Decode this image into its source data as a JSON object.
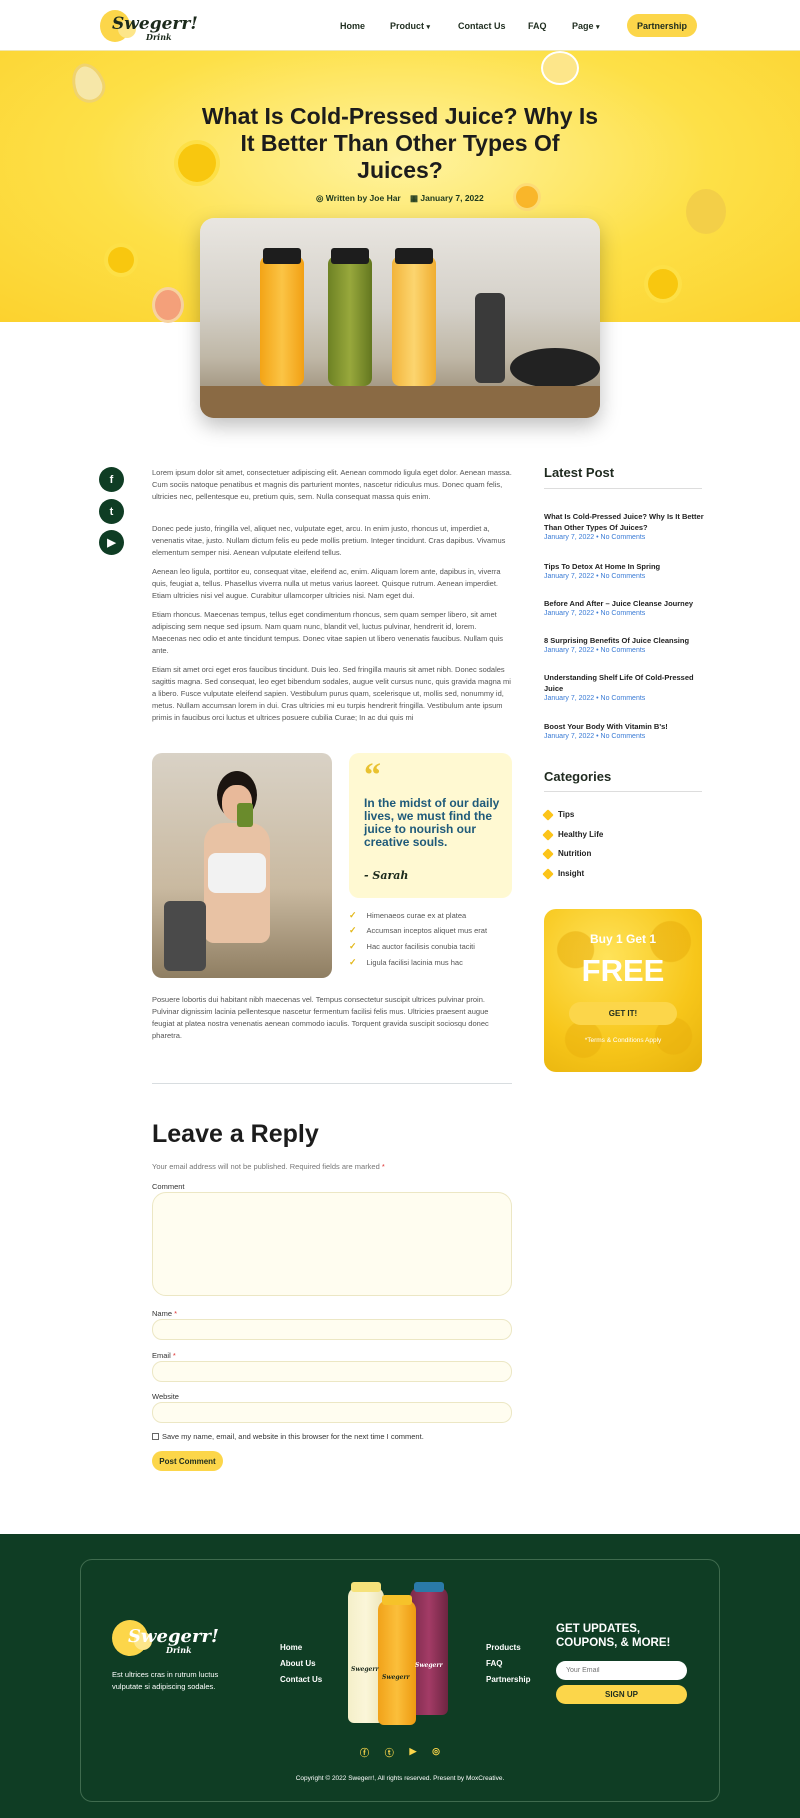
{
  "header": {
    "logo_text": "Swegerr!",
    "logo_sub": "Drink",
    "nav": [
      "Home",
      "Product",
      "Contact Us",
      "FAQ",
      "Page"
    ],
    "partnership_button": "Partnership"
  },
  "hero": {
    "title": "What Is Cold-Pressed Juice? Why Is It Better Than Other Types Of Juices?",
    "author": "Written by Joe Har",
    "date": "January 7, 2022"
  },
  "article": {
    "paragraphs": [
      "Lorem ipsum dolor sit amet, consectetuer adipiscing elit. Aenean commodo ligula eget dolor. Aenean massa. Cum sociis natoque penatibus et magnis dis parturient montes, nascetur ridiculus mus. Donec quam felis, ultricies nec, pellentesque eu, pretium quis, sem. Nulla consequat massa quis enim.",
      "Donec pede justo, fringilla vel, aliquet nec, vulputate eget, arcu. In enim justo, rhoncus ut, imperdiet a, venenatis vitae, justo. Nullam dictum felis eu pede mollis pretium. Integer tincidunt. Cras dapibus. Vivamus elementum semper nisi. Aenean vulputate eleifend tellus.",
      "Aenean leo ligula, porttitor eu, consequat vitae, eleifend ac, enim. Aliquam lorem ante, dapibus in, viverra quis, feugiat a, tellus. Phasellus viverra nulla ut metus varius laoreet. Quisque rutrum. Aenean imperdiet. Etiam ultricies nisi vel augue. Curabitur ullamcorper ultricies nisi. Nam eget dui.",
      "Etiam rhoncus. Maecenas tempus, tellus eget condimentum rhoncus, sem quam semper libero, sit amet adipiscing sem neque sed ipsum. Nam quam nunc, blandit vel, luctus pulvinar, hendrerit id, lorem. Maecenas nec odio et ante tincidunt tempus. Donec vitae sapien ut libero venenatis faucibus. Nullam quis ante.",
      "Etiam sit amet orci eget eros faucibus tincidunt. Duis leo. Sed fringilla mauris sit amet nibh. Donec sodales sagittis magna. Sed consequat, leo eget bibendum sodales, augue velit cursus nunc, quis gravida magna mi a libero. Fusce vulputate eleifend sapien. Vestibulum purus quam, scelerisque ut, mollis sed, nonummy id, metus. Nullam accumsan lorem in dui. Cras ultricies mi eu turpis hendrerit fringilla. Vestibulum ante ipsum primis in faucibus orci luctus et ultrices posuere cubilia Curae; In ac dui quis mi"
    ],
    "quote_mark": "“",
    "quote": "In the midst of our daily lives, we must find the juice to nourish our creative souls.",
    "quote_author": "- Sarah",
    "checklist": [
      "Himenaeos curae ex at platea",
      "Accumsan inceptos aliquet mus erat",
      "Hac auctor facilisis conubia taciti",
      "Ligula facilisi lacinia mus hac"
    ],
    "closing_paragraph": "Posuere lobortis dui habitant nibh maecenas vel. Tempus consectetur suscipit ultrices pulvinar proin. Pulvinar dignissim lacinia pellentesque nascetur fermentum facilisi felis mus. Ultricies praesent augue feugiat at platea nostra venenatis aenean commodo iaculis. Torquent gravida suscipit sociosqu donec pharetra."
  },
  "sidebar": {
    "latest_heading": "Latest Post",
    "posts": [
      {
        "title": "What Is Cold-Pressed Juice? Why Is It Better Than Other Types Of Juices?",
        "meta": "January 7, 2022 • No Comments"
      },
      {
        "title": "Tips To Detox At Home In Spring",
        "meta": "January 7, 2022 • No Comments"
      },
      {
        "title": "Before And After – Juice Cleanse Journey",
        "meta": "January 7, 2022 • No Comments"
      },
      {
        "title": "8 Surprising Benefits Of Juice Cleansing",
        "meta": "January 7, 2022 • No Comments"
      },
      {
        "title": "Understanding Shelf Life Of Cold-Pressed Juice",
        "meta": "January 7, 2022 • No Comments"
      },
      {
        "title": "Boost Your Body With Vitamin B's!",
        "meta": "January 7, 2022 • No Comments"
      }
    ],
    "categories_heading": "Categories",
    "categories": [
      "Tips",
      "Healthy Life",
      "Nutrition",
      "Insight"
    ],
    "promo_top": "Buy 1 Get 1",
    "promo_big": "FREE",
    "promo_button": "GET IT!",
    "promo_terms": "*Terms & Conditions Apply"
  },
  "reply": {
    "heading": "Leave a Reply",
    "note": "Your email address will not be published.",
    "required_note": "Required fields are marked",
    "asterisk": "*",
    "comment_label": "Comment",
    "name_label": "Name",
    "email_label": "Email",
    "website_label": "Website",
    "save_label": "Save my name, email, and website in this browser for the next time I comment.",
    "submit": "Post Comment"
  },
  "footer": {
    "logo_text": "Swegerr!",
    "logo_sub": "Drink",
    "tagline": "Est ultrices cras in rutrum luctus vulputate si adipiscing sodales.",
    "links_left": [
      "Home",
      "About Us",
      "Contact Us"
    ],
    "links_right": [
      "Products",
      "FAQ",
      "Partnership"
    ],
    "bottle_labels": [
      "Swegerr",
      "Swegerr",
      "Swegerr"
    ],
    "newsletter_heading": "GET UPDATES, COUPONS, & MORE!",
    "email_placeholder": "Your Email",
    "signup_button": "SIGN UP",
    "social_icons": [
      "facebook-icon",
      "twitter-icon",
      "youtube-icon",
      "instagram-icon"
    ],
    "copyright": "Copyright © 2022 Swegerr!, All rights reserved. Present by MoxCreative."
  },
  "colors": {
    "brand_yellow": "#fcd64a",
    "dark_green": "#0f3d24",
    "link_blue": "#3a7bd5"
  }
}
